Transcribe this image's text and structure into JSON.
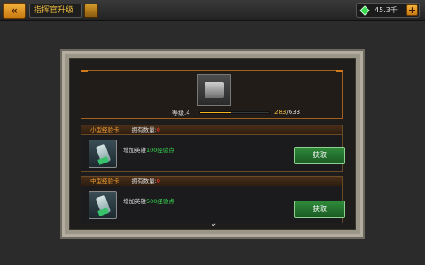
{
  "header": {
    "back_glyph": "«",
    "title": "指挥官升级",
    "currency": {
      "icon": "gem-icon",
      "value": "45.3千",
      "plus_label": "+"
    }
  },
  "commander": {
    "level_label": "等级.4",
    "exp_current": "283",
    "exp_sep": "/",
    "exp_max": "633",
    "exp_progress": 0.447
  },
  "items": [
    {
      "name": "小型经验卡",
      "owned_label": "拥有数量:",
      "owned_count": "0",
      "desc_prefix": "增加英雄",
      "desc_exp": "100经验点",
      "button_label": "获取"
    },
    {
      "name": "中型经验卡",
      "owned_label": "拥有数量:",
      "owned_count": "0",
      "desc_prefix": "增加英雄",
      "desc_exp": "500经验点",
      "button_label": "获取"
    }
  ],
  "scroll_glyph": "⌄",
  "colors": {
    "accent": "#f0c040",
    "exp_green": "#3bdc52",
    "danger": "#ff3b30"
  }
}
